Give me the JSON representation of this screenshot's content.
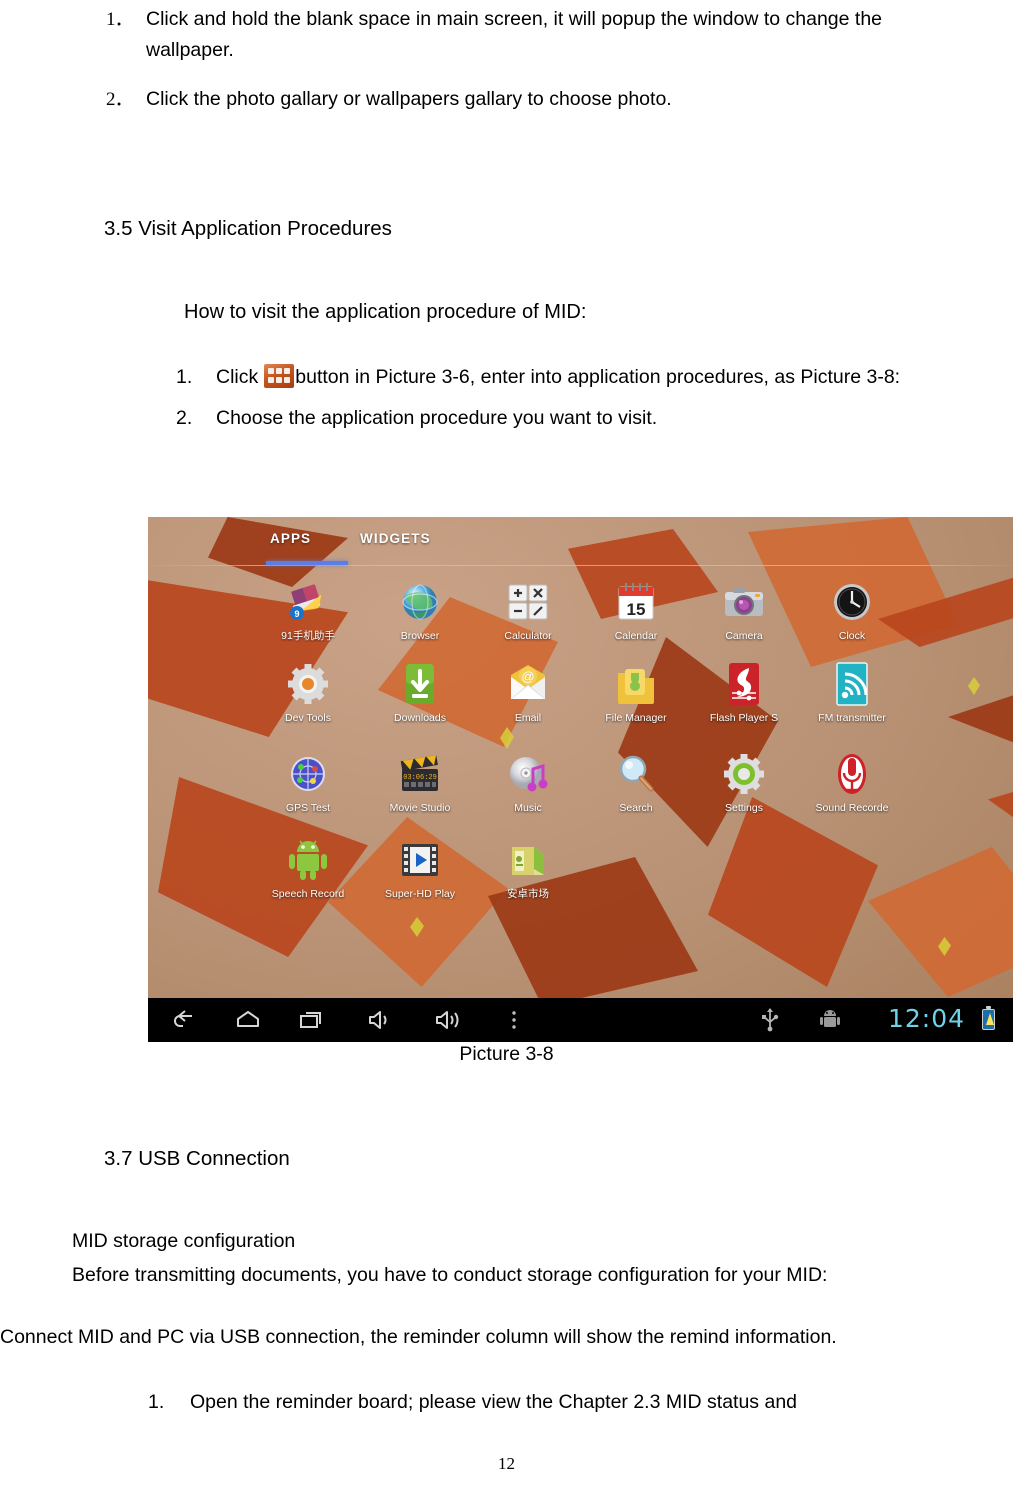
{
  "document": {
    "page_number": "12",
    "top_steps": [
      {
        "marker": "1．",
        "text": "Click and hold the blank space in main screen, it will popup the window to change the wallpaper."
      },
      {
        "marker": "2．",
        "text": "Click the photo gallary or wallpapers gallary to choose photo."
      }
    ],
    "section_35": {
      "heading": "3.5 Visit Application Procedures",
      "intro": "How to visit the application procedure of MID:",
      "steps": [
        {
          "marker": "1.",
          "text_before_icon": "Click",
          "icon": "app-grid-icon",
          "text_after_icon": "button in Picture 3-6, enter into application procedures, as Picture 3-8:"
        },
        {
          "marker": "2.",
          "text_before_icon": "Choose the application procedure you want to visit.",
          "icon": "",
          "text_after_icon": ""
        }
      ]
    },
    "figure": {
      "caption": "Picture 3-8"
    },
    "section_37": {
      "heading": "3.7 USB Connection",
      "line1": "MID storage configuration",
      "line2": "Before transmitting documents, you have to conduct storage configuration for your MID:",
      "line3": "Connect MID and PC via USB connection, the reminder column will show the remind information.",
      "steps": [
        {
          "marker": "1.",
          "text": "Open the reminder board; please view the Chapter 2.3 MID status and"
        }
      ]
    }
  },
  "screenshot": {
    "tabs": [
      {
        "label": "APPS",
        "selected": true
      },
      {
        "label": "WIDGETS",
        "selected": false
      }
    ],
    "accent_color": "#5b7de8",
    "apps": [
      {
        "label": "91手机助手",
        "icon": "assistant-91-icon"
      },
      {
        "label": "Browser",
        "icon": "browser-globe-icon"
      },
      {
        "label": "Calculator",
        "icon": "calculator-icon"
      },
      {
        "label": "Calendar",
        "icon": "calendar-icon"
      },
      {
        "label": "Camera",
        "icon": "camera-icon"
      },
      {
        "label": "Clock",
        "icon": "clock-icon"
      },
      {
        "label": "Dev Tools",
        "icon": "dev-tools-gear-icon"
      },
      {
        "label": "Downloads",
        "icon": "downloads-icon"
      },
      {
        "label": "Email",
        "icon": "email-icon"
      },
      {
        "label": "File Manager",
        "icon": "file-manager-icon"
      },
      {
        "label": "Flash Player S",
        "icon": "flash-player-icon"
      },
      {
        "label": "FM transmitter",
        "icon": "fm-transmitter-icon"
      },
      {
        "label": "GPS Test",
        "icon": "gps-test-icon"
      },
      {
        "label": "Movie Studio",
        "icon": "movie-studio-icon"
      },
      {
        "label": "Music",
        "icon": "music-icon"
      },
      {
        "label": "Search",
        "icon": "search-magnifier-icon"
      },
      {
        "label": "Settings",
        "icon": "settings-gear-icon"
      },
      {
        "label": "Sound Recorde",
        "icon": "sound-recorder-icon"
      },
      {
        "label": "Speech Record",
        "icon": "speech-record-android-icon"
      },
      {
        "label": "Super-HD Play",
        "icon": "super-hd-player-icon"
      },
      {
        "label": "安卓市场",
        "icon": "android-market-icon"
      }
    ],
    "navbar": {
      "buttons": [
        {
          "name": "back-icon"
        },
        {
          "name": "home-icon"
        },
        {
          "name": "recents-icon"
        },
        {
          "name": "volume-down-icon"
        },
        {
          "name": "volume-up-icon"
        },
        {
          "name": "menu-overflow-icon"
        }
      ],
      "status": {
        "usb_icon": "usb-icon",
        "debug_icon": "android-debug-icon",
        "time": "12:04",
        "battery_icon": "battery-charging-icon",
        "time_color": "#6fd3e8"
      }
    }
  }
}
